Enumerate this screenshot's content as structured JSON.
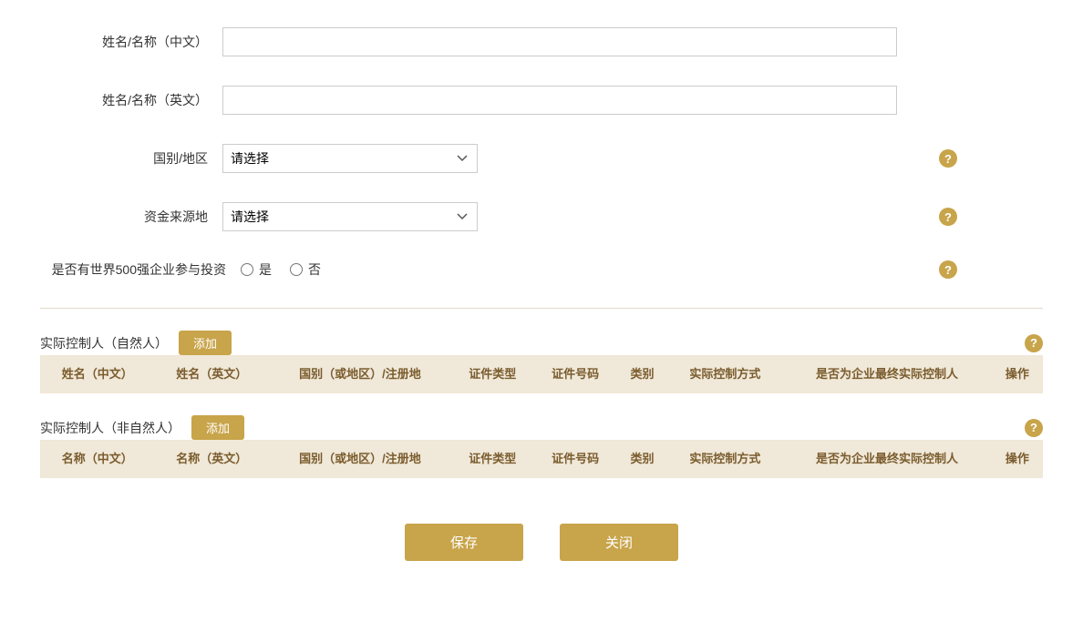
{
  "form": {
    "name_cn_label": "姓名/名称（中文）",
    "name_en_label": "姓名/名称（英文）",
    "country_label": "国别/地区",
    "fund_source_label": "资金来源地",
    "fortune500_label": "是否有世界500强企业参与投资",
    "yes_label": "是",
    "no_label": "否",
    "country_placeholder": "请选择",
    "fund_source_placeholder": "请选择"
  },
  "section1": {
    "title": "实际控制人（自然人）",
    "add_label": "添加"
  },
  "section2": {
    "title": "实际控制人（非自然人）",
    "add_label": "添加"
  },
  "table1": {
    "columns": [
      "姓名（中文）",
      "姓名（英文）",
      "国别（或地区）/注册地",
      "证件类型",
      "证件号码",
      "类别",
      "实际控制方式",
      "是否为企业最终实际控制人",
      "操作"
    ]
  },
  "table2": {
    "columns": [
      "名称（中文）",
      "名称（英文）",
      "国别（或地区）/注册地",
      "证件类型",
      "证件号码",
      "类别",
      "实际控制方式",
      "是否为企业最终实际控制人",
      "操作"
    ]
  },
  "actions": {
    "save_label": "保存",
    "close_label": "关闭"
  },
  "help_icon_symbol": "?"
}
